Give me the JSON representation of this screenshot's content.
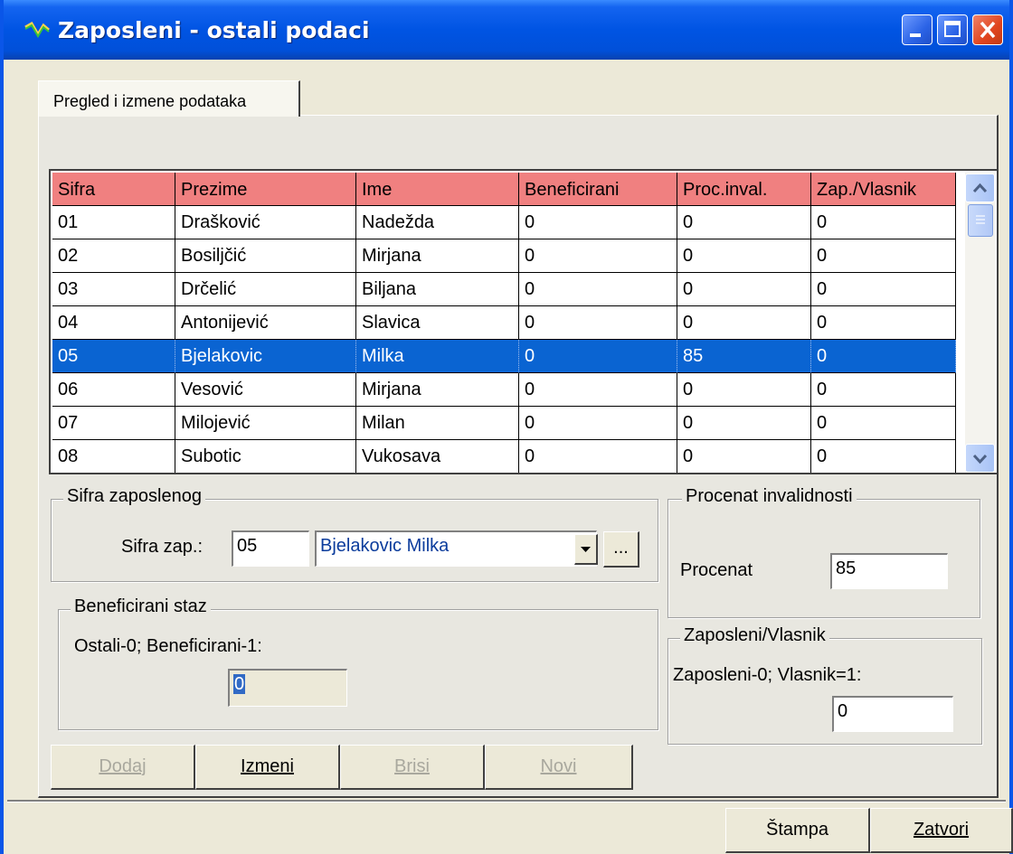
{
  "window": {
    "title": "Zaposleni - ostali podaci"
  },
  "tabs": [
    {
      "label": "Pregled i izmene podataka"
    }
  ],
  "grid": {
    "columns": [
      "Sifra",
      "Prezime",
      "Ime",
      "Beneficirani",
      "Proc.inval.",
      "Zap./Vlasnik"
    ],
    "rows": [
      [
        "01",
        "Drašković",
        "Nadežda",
        "0",
        "0",
        "0"
      ],
      [
        "02",
        "Bosiljčić",
        "Mirjana",
        "0",
        "0",
        "0"
      ],
      [
        "03",
        "Drčelić",
        "Biljana",
        "0",
        "0",
        "0"
      ],
      [
        "04",
        "Antonijević",
        "Slavica",
        "0",
        "0",
        "0"
      ],
      [
        "05",
        "Bjelakovic",
        "Milka",
        "0",
        "85",
        "0"
      ],
      [
        "06",
        "Vesović",
        "Mirjana",
        "0",
        "0",
        "0"
      ],
      [
        "07",
        "Milojević",
        "Milan",
        "0",
        "0",
        "0"
      ],
      [
        "08",
        "Subotic",
        "Vukosava",
        "0",
        "0",
        "0"
      ]
    ],
    "selected_row": 4
  },
  "sifra_group": {
    "legend": "Sifra zaposlenog",
    "label": "Sifra zap.:",
    "code_value": "05",
    "combo_value": "Bjelakovic Milka",
    "browse_label": "..."
  },
  "procenat_group": {
    "legend": "Procenat invalidnosti",
    "label": "Procenat",
    "value": "85"
  },
  "beneficirani_group": {
    "legend": "Beneficirani staz",
    "hint": "Ostali-0; Beneficirani-1:",
    "value": "0"
  },
  "vlasnik_group": {
    "legend": "Zaposleni/Vlasnik",
    "hint": "Zaposleni-0; Vlasnik=1:",
    "value": "0"
  },
  "actions": {
    "dodaj": "Dodaj",
    "izmeni": "Izmeni",
    "brisi": "Brisi",
    "novi": "Novi"
  },
  "footer": {
    "stampa": "Štampa",
    "zatvori": "Zatvori"
  },
  "colors": {
    "header_bg": "#F08080",
    "selection_bg": "#0A64D2",
    "titlebar": "#0054E3"
  }
}
